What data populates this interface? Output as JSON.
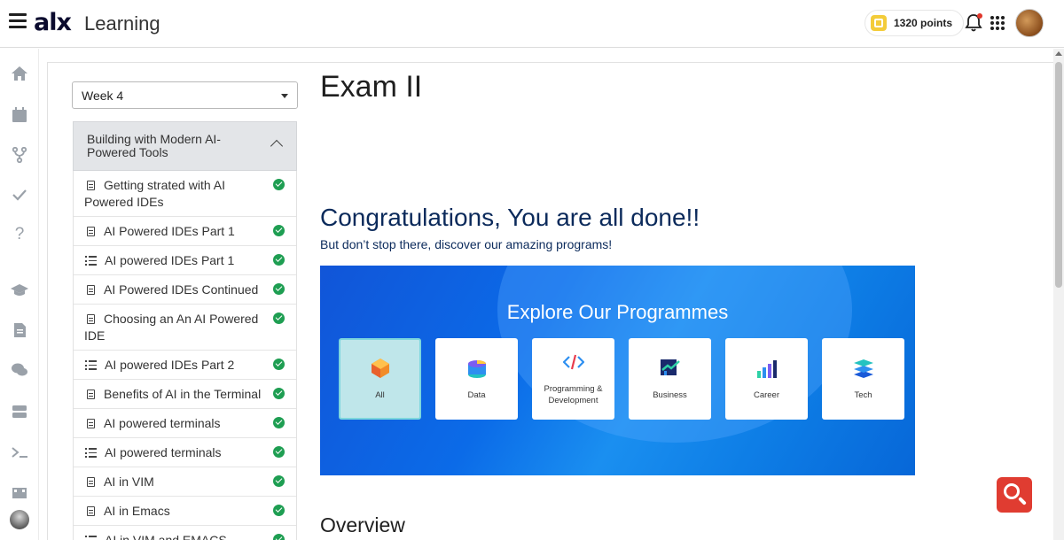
{
  "header": {
    "logo": "alx",
    "product": "Learning",
    "points": "1320 points"
  },
  "sidebar": {
    "week": "Week 4",
    "section_title": "Building with Modern AI-Powered Tools",
    "items": [
      {
        "label": "Getting strated with AI Powered IDEs",
        "type": "doc"
      },
      {
        "label": "AI Powered IDEs Part 1",
        "type": "doc"
      },
      {
        "label": "AI powered IDEs Part 1",
        "type": "task"
      },
      {
        "label": "AI Powered IDEs Continued",
        "type": "doc"
      },
      {
        "label": "Choosing an An AI Powered IDE",
        "type": "doc"
      },
      {
        "label": "AI powered IDEs Part 2",
        "type": "task"
      },
      {
        "label": "Benefits of AI in the Terminal",
        "type": "doc"
      },
      {
        "label": "AI powered terminals",
        "type": "doc"
      },
      {
        "label": "AI powered terminals",
        "type": "task"
      },
      {
        "label": "AI in VIM",
        "type": "doc"
      },
      {
        "label": "AI in Emacs",
        "type": "doc"
      },
      {
        "label": "AI in VIM and EMACS",
        "type": "task"
      }
    ]
  },
  "main": {
    "title": "Exam II",
    "congrats": "Congratulations, You are all done!!",
    "subtitle": "But don’t stop there, discover our amazing programs!",
    "banner_title": "Explore Our Programmes",
    "programmes": [
      {
        "label": "All",
        "icon": "cube-icon"
      },
      {
        "label": "Data",
        "icon": "database-icon"
      },
      {
        "label": "Programming & Development",
        "icon": "code-icon"
      },
      {
        "label": "Business",
        "icon": "business-icon"
      },
      {
        "label": "Career",
        "icon": "bar-chart-icon"
      },
      {
        "label": "Tech",
        "icon": "layers-icon"
      }
    ],
    "overview": "Overview"
  },
  "colors": {
    "accent": "#e03c31",
    "complete": "#1e9e52",
    "heading": "#0b2a5b",
    "banner": "#0b6be8"
  }
}
